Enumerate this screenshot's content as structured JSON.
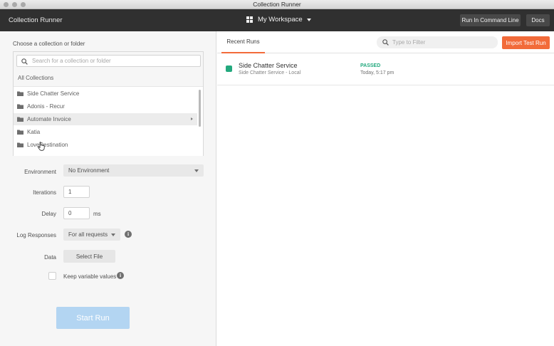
{
  "window": {
    "title": "Collection Runner"
  },
  "header": {
    "app_title": "Collection Runner",
    "workspace": "My Workspace",
    "run_command_line": "Run In Command Line",
    "docs": "Docs"
  },
  "left": {
    "choose_label": "Choose a collection or folder",
    "search": {
      "placeholder": "Search for a collection or folder",
      "value": ""
    },
    "all_collections": "All Collections",
    "collections": [
      {
        "label": "Side Chatter Service"
      },
      {
        "label": "Adonis - Recur"
      },
      {
        "label": "Automate Invoice"
      },
      {
        "label": "Katia"
      },
      {
        "label": "LoveDestination"
      }
    ],
    "environment": {
      "label": "Environment",
      "selected": "No Environment"
    },
    "iterations": {
      "label": "Iterations",
      "value": "1"
    },
    "delay": {
      "label": "Delay",
      "value": "0",
      "unit": "ms"
    },
    "log_responses": {
      "label": "Log Responses",
      "selected": "For all requests"
    },
    "data": {
      "label": "Data",
      "button": "Select File"
    },
    "keep_values": {
      "label": "Keep variable values",
      "checked": false
    },
    "start_run": "Start Run"
  },
  "right": {
    "tab_label": "Recent Runs",
    "filter": {
      "placeholder": "Type to Filter",
      "value": ""
    },
    "import_button": "Import Test Run",
    "runs": [
      {
        "name": "Side Chatter Service",
        "environment": "Side Chatter Service - Local",
        "result": "PASSED",
        "time": "Today, 5:17 pm",
        "status_color": "#23a97e"
      }
    ]
  },
  "colors": {
    "accent": "#f26b3a",
    "header_bg": "#303030",
    "passed": "#23a97e",
    "start_run_disabled": "#b3d5f2"
  }
}
